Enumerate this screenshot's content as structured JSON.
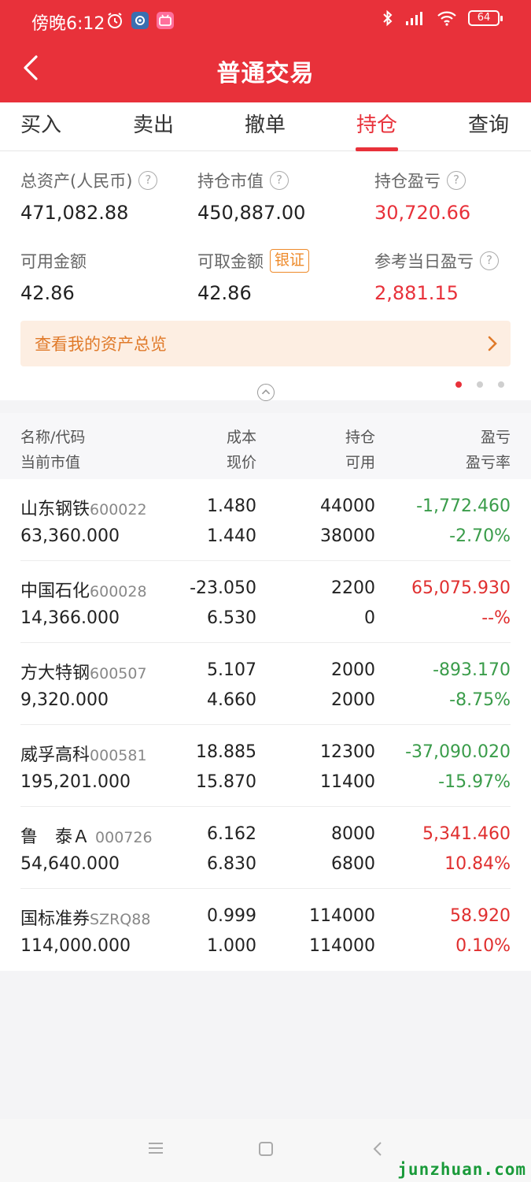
{
  "status_bar": {
    "time": "傍晚6:12",
    "battery": "64"
  },
  "nav": {
    "title": "普通交易"
  },
  "tabs": [
    {
      "label": "买入"
    },
    {
      "label": "卖出"
    },
    {
      "label": "撤单"
    },
    {
      "label": "持仓",
      "active": true
    },
    {
      "label": "查询"
    }
  ],
  "summary": {
    "total_assets": {
      "label": "总资产(人民币)",
      "value": "471,082.88"
    },
    "position_value": {
      "label": "持仓市值",
      "value": "450,887.00"
    },
    "position_pnl": {
      "label": "持仓盈亏",
      "value": "30,720.66"
    },
    "available": {
      "label": "可用金额",
      "value": "42.86"
    },
    "withdrawable": {
      "label": "可取金额",
      "value": "42.86",
      "badge": "银证"
    },
    "today_pnl": {
      "label": "参考当日盈亏",
      "value": "2,881.15"
    }
  },
  "overview_banner": {
    "text": "查看我的资产总览"
  },
  "table_header": {
    "col1_top": "名称/代码",
    "col1_bottom": "当前市值",
    "col2_top": "成本",
    "col2_bottom": "现价",
    "col3_top": "持仓",
    "col3_bottom": "可用",
    "col4_top": "盈亏",
    "col4_bottom": "盈亏率"
  },
  "positions": [
    {
      "name": "山东钢铁",
      "code": "600022",
      "market_value": "63,360.000",
      "cost": "1.480",
      "price": "1.440",
      "holding": "44000",
      "available": "38000",
      "pnl": "-1,772.460",
      "pnl_rate": "-2.70%",
      "trend": "down"
    },
    {
      "name": "中国石化",
      "code": "600028",
      "market_value": "14,366.000",
      "cost": "-23.050",
      "price": "6.530",
      "holding": "2200",
      "available": "0",
      "pnl": "65,075.930",
      "pnl_rate": "--%",
      "trend": "up"
    },
    {
      "name": "方大特钢",
      "code": "600507",
      "market_value": "9,320.000",
      "cost": "5.107",
      "price": "4.660",
      "holding": "2000",
      "available": "2000",
      "pnl": "-893.170",
      "pnl_rate": "-8.75%",
      "trend": "down"
    },
    {
      "name": "威孚高科",
      "code": "000581",
      "market_value": "195,201.000",
      "cost": "18.885",
      "price": "15.870",
      "holding": "12300",
      "available": "11400",
      "pnl": "-37,090.020",
      "pnl_rate": "-15.97%",
      "trend": "down"
    },
    {
      "name": "鲁　泰Ａ",
      "code": "000726",
      "market_value": "54,640.000",
      "cost": "6.162",
      "price": "6.830",
      "holding": "8000",
      "available": "6800",
      "pnl": "5,341.460",
      "pnl_rate": "10.84%",
      "trend": "up"
    },
    {
      "name": "国标准券",
      "code": "SZRQ88",
      "market_value": "114,000.000",
      "cost": "0.999",
      "price": "1.000",
      "holding": "114000",
      "available": "114000",
      "pnl": "58.920",
      "pnl_rate": "0.10%",
      "trend": "up"
    }
  ],
  "watermark": "junzhuan.com",
  "colors": {
    "brand_red": "#e8313a",
    "loss_green": "#3a9c4a",
    "gain_red": "#e02f2f",
    "banner_orange": "#e07a2a"
  }
}
